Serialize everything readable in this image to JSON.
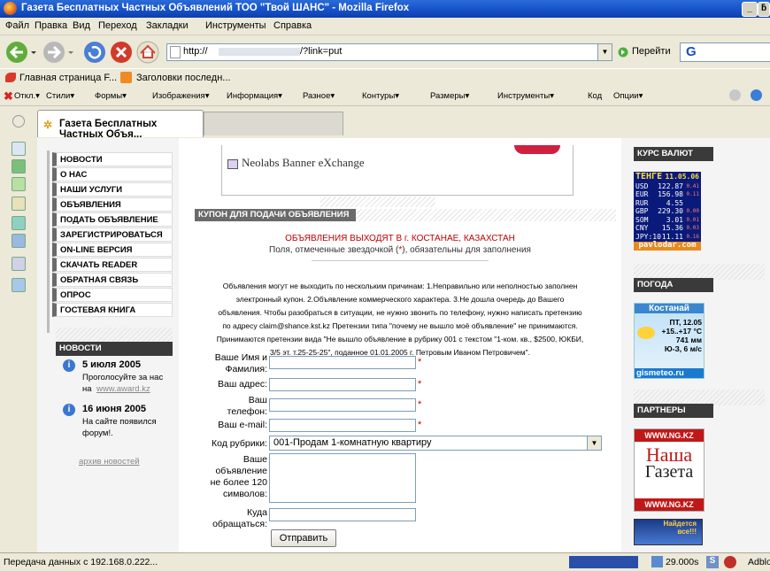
{
  "window": {
    "title": "Газета Бесплатных Частных Объявлений ТОО \"Твой ШАНС\" - Mozilla Firefox",
    "minimize": "_",
    "maximize": "ƃ"
  },
  "menu": [
    "Файл",
    "Правка",
    "Вид",
    "Переход",
    "Закладки",
    "Инструменты",
    "Справка"
  ],
  "nav": {
    "url_prefix": "http://",
    "url_suffix": "/?link=put",
    "go_label": "Перейти",
    "search_value": "G"
  },
  "bookmarks": [
    "Главная страница F...",
    "Заголовки последн..."
  ],
  "webdev_toolbar": [
    "Откл.▾",
    "Стили▾",
    "Формы▾",
    "Изображения▾",
    "Информация▾",
    "Разное▾",
    "Контуры▾",
    "Размеры▾",
    "Инструменты▾",
    "Код",
    "Опции▾"
  ],
  "tab": {
    "title": "Газета Бесплатных Частных Объя..."
  },
  "left_menu": [
    "НОВОСТИ",
    "О НАС",
    "НАШИ УСЛУГИ",
    "ОБЪЯВЛЕНИЯ",
    "ПОДАТЬ ОБЪЯВЛЕНИЕ",
    "ЗАРЕГИСТРИРОВАТЬСЯ",
    "ON-LINE ВЕРСИЯ",
    "СКАЧАТЬ READER",
    "ОБРАТНАЯ СВЯЗЬ",
    "ОПРОС",
    "ГОСТЕВАЯ КНИГА"
  ],
  "news": {
    "header": "НОВОСТИ",
    "items": [
      {
        "date": "5 июля 2005",
        "text1": "Проголосуйте за нас",
        "text2": "на",
        "link": "www.award.kz"
      },
      {
        "date": "16 июня 2005",
        "text1": "На сайте появился",
        "text2": "форум!."
      }
    ],
    "archive": "архив новостей"
  },
  "banner": {
    "text": "Neolabs Banner eXchange"
  },
  "coupon": {
    "header": "КУПОН ДЛЯ ПОДАЧИ ОБЪЯВЛЕНИЯ",
    "city_notice": "ОБЪЯВЛЕНИЯ ВЫХОДЯТ В г. КОСТАНАЕ, КАЗАХСТАН",
    "required_notice_a": "Поля, отмеченные звездочкой (",
    "required_star": "*",
    "required_notice_b": "), обязательны для заполнения",
    "notice_lines": [
      "Объявления могут не выходить по нескольким причинам: 1.Неправильно или неполностью заполнен",
      "электронный купон. 2.Объявление коммерческого характера. 3.Не дошла очередь до Вашего",
      "объявления. Чтобы разобраться в ситуации, не нужно звонить по телефону, нужно написать претензию",
      "по адресу claim@shance.kst.kz Претензии типа \"почему не вышло моё объявление\" не принимаются.",
      "Принимаются претензии вида \"Не вышло объявление в рубрику 001 с текстом \"1-ком. кв., $2500, ЮКБИ,",
      "3/5 эт. т.25-25-25\", поданное 01.01.2005 г. Петровым Иваном Петровичем\"."
    ],
    "fields": {
      "name_l1": "Ваше Имя и",
      "name_l2": "Фамилия:",
      "address": "Ваш адрес:",
      "phone_l1": "Ваш",
      "phone_l2": "телефон:",
      "email": "Ваш e-mail:",
      "rubric_label": "Код рубрики:",
      "rubric_value": "001-Продам 1-комнатную квартиру",
      "text_l1": "Ваше",
      "text_l2": "объявление",
      "text_l3": "не более  120",
      "text_l4": "символов:",
      "where_l1": "Куда",
      "where_l2": "обращаться:"
    },
    "submit": "Отправить"
  },
  "currency": {
    "header": "КУРС ВАЛЮТ",
    "brand": "ТЕНГЕ",
    "date": "11.05.06",
    "rows": [
      {
        "code": "USD",
        "rate": "122.87",
        "delta": "0.41"
      },
      {
        "code": "EUR",
        "rate": "156.98",
        "delta": "0.11"
      },
      {
        "code": "RUR",
        "rate": "4.55",
        "delta": ""
      },
      {
        "code": "GBP",
        "rate": "229.30",
        "delta": "0.00"
      },
      {
        "code": "SOM",
        "rate": "3.01",
        "delta": "0.01"
      },
      {
        "code": "CNY",
        "rate": "15.36",
        "delta": "0.03"
      },
      {
        "code": "JPY:10",
        "rate": "11.11",
        "delta": "0.16"
      }
    ],
    "source": "pavlodar.com"
  },
  "weather": {
    "header": "ПОГОДА",
    "city": "Костанай",
    "date": "ПТ, 12.05",
    "temp": "+15..+17 °C",
    "pressure": "741 мм",
    "wind": "Ю-З, 6 м/с",
    "source": "gismeteo.ru"
  },
  "partners": {
    "header": "ПАРТНЕРЫ",
    "site": "WWW.NG.KZ",
    "logo1": "Наша",
    "logo2": "Газета",
    "site2": "WWW.NG.KZ",
    "badge1": "Найдется",
    "badge2": "все!!!"
  },
  "status": {
    "text": "Передача данных с 192.168.0.222...",
    "time": "29.000s",
    "adblock": "Adblo"
  },
  "colors": {
    "titlebar": "#1450c8",
    "red": "#c00000",
    "menu_dark": "#3a3a3a",
    "page": "#f4f4f4"
  }
}
